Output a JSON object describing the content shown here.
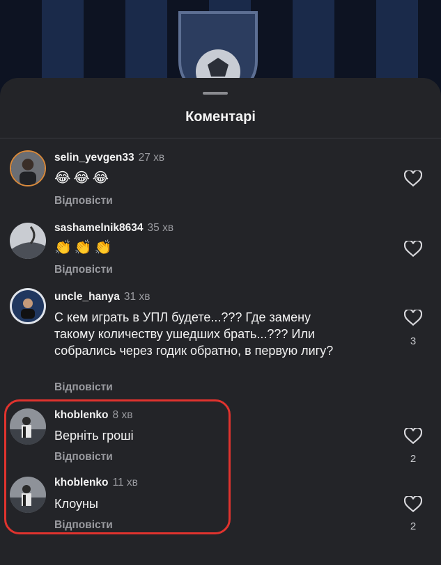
{
  "sheet": {
    "title": "Коментарі"
  },
  "comments": [
    {
      "username": "selin_yevgen33",
      "time": "27 хв",
      "text": "😂😂😂",
      "reply": "Відповісти",
      "likes": ""
    },
    {
      "username": "sashamelnik8634",
      "time": "35 хв",
      "text": "👏👏👏",
      "reply": "Відповісти",
      "likes": ""
    },
    {
      "username": "uncle_hanya",
      "time": "31 хв",
      "text": "С кем играть в УПЛ будете...??? Где замену такому количеству ушедших брать...??? Или собрались через годик обратно, в первую лигу?",
      "reply": "Відповісти",
      "likes": "3"
    },
    {
      "username": "khoblenko",
      "time": "8 хв",
      "text": "Верніть гроші",
      "reply": "Відповісти",
      "likes": "2"
    },
    {
      "username": "khoblenko",
      "time": "11 хв",
      "text": "Клоуны",
      "reply": "Відповісти",
      "likes": "2"
    }
  ],
  "colors": {
    "highlight": "#e0332e",
    "background": "#232428"
  }
}
